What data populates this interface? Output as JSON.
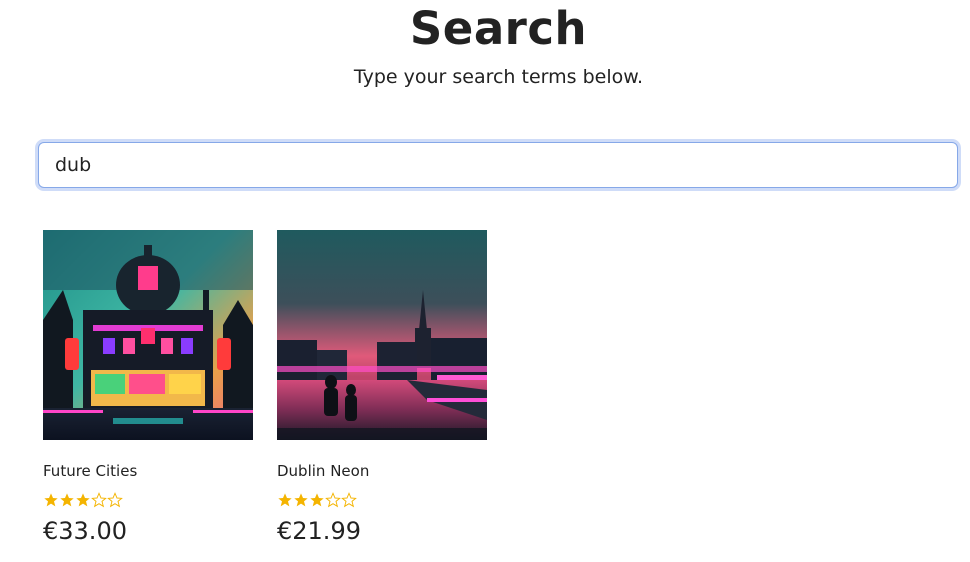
{
  "header": {
    "title": "Search",
    "subtitle": "Type your search terms below."
  },
  "search": {
    "value": "dub"
  },
  "colors": {
    "star": "#f4b400",
    "focus_ring": "#cfdcf8",
    "input_border": "#86a8e8"
  },
  "results": [
    {
      "title": "Future Cities",
      "rating": 3,
      "max_rating": 5,
      "price": "€33.00",
      "image_icon": "neon-building-image"
    },
    {
      "title": "Dublin Neon",
      "rating": 3,
      "max_rating": 5,
      "price": "€21.99",
      "image_icon": "neon-river-city-image"
    }
  ]
}
